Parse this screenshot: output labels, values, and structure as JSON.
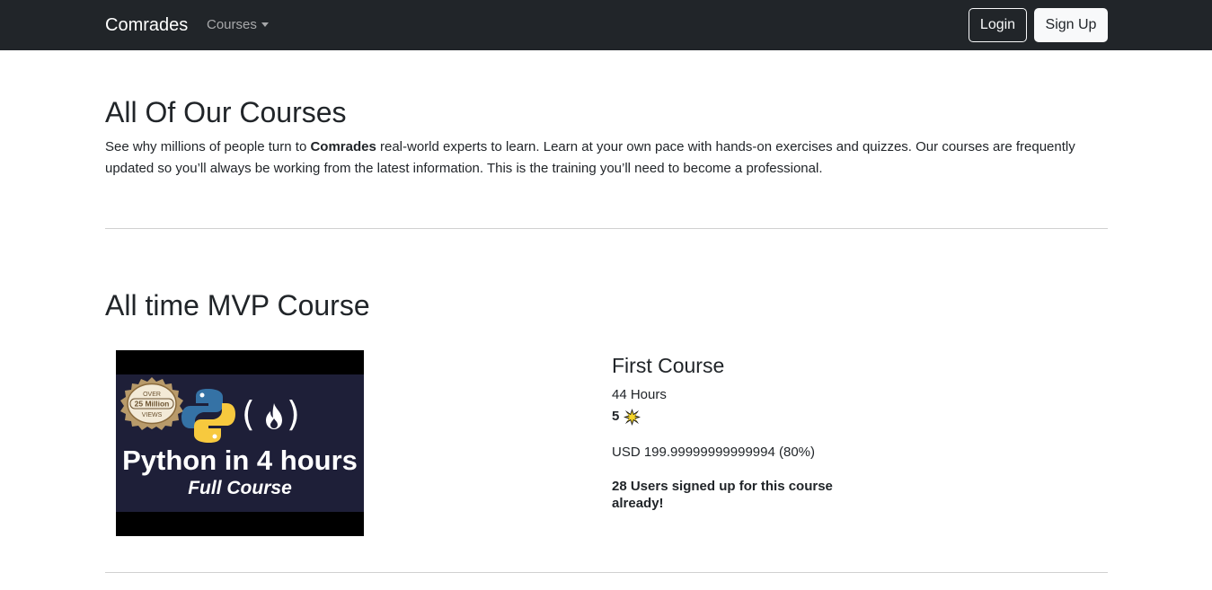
{
  "navbar": {
    "brand": "Comrades",
    "courses_menu": "Courses",
    "login_label": "Login",
    "signup_label": "Sign Up"
  },
  "intro": {
    "title": "All Of Our Courses",
    "text_before": "See why millions of people turn to ",
    "text_bold": "Comrades",
    "text_after": " real-world experts to learn. Learn at your own pace with hands-on exercises and quizzes. Our courses are frequently updated so you’ll always be working from the latest information. This is the training you’ll need to become a professional."
  },
  "mvp": {
    "section_title": "All time MVP Course",
    "thumbnail": {
      "seal_over": "OVER",
      "seal_count": "25 Million",
      "seal_views": "VIEWS",
      "title": "Python in 4 hours",
      "subtitle": "Full Course"
    },
    "course": {
      "title": "First Course",
      "hours": "44 Hours",
      "rating": "5",
      "price": "USD 199.99999999999994 (80%)",
      "signups": "28 Users signed up for this course already!"
    }
  },
  "colors": {
    "navbar_bg": "#212529",
    "thumb_bg": "#1e1f38",
    "python_blue": "#3572a5",
    "python_yellow": "#f7c93e"
  }
}
